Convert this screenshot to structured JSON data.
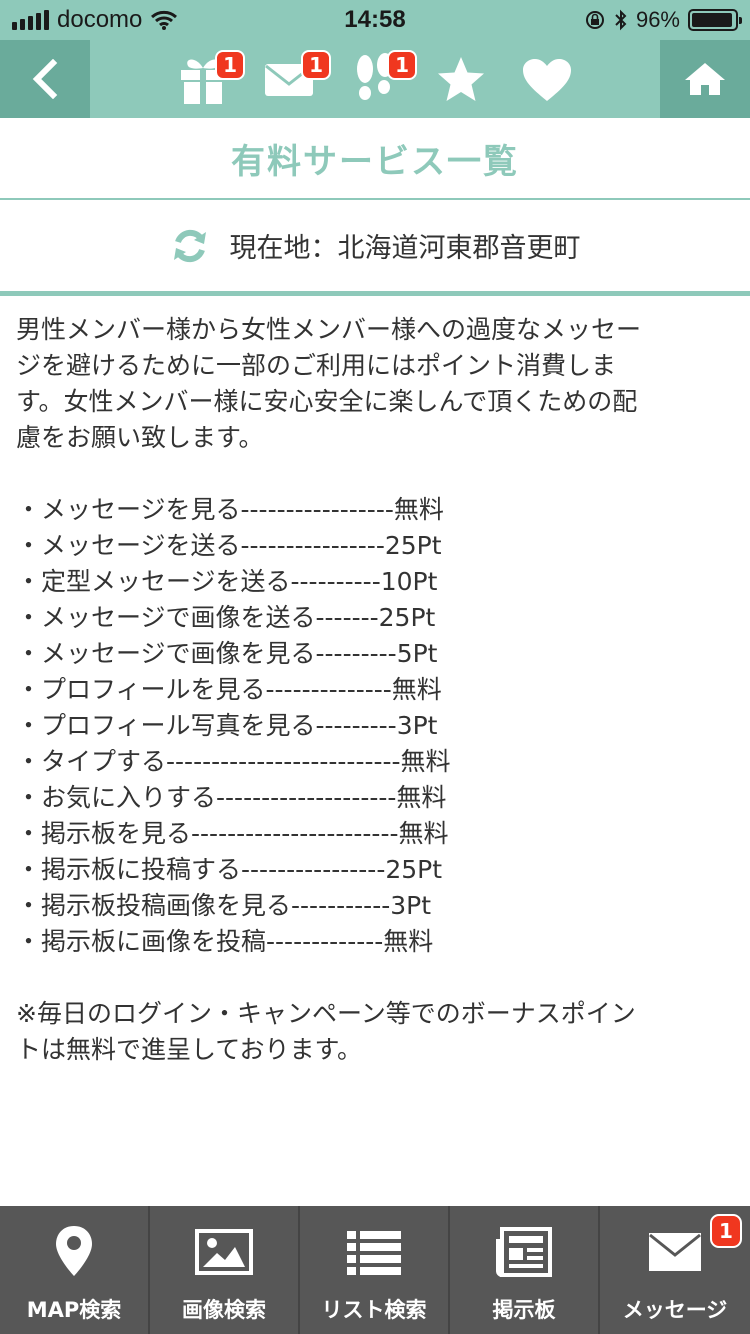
{
  "status_bar": {
    "carrier": "docomo",
    "time": "14:58",
    "battery_text": "96%",
    "battery_level_percent": 96,
    "icons": [
      "signal-icon",
      "wifi-icon",
      "orientation-lock-icon",
      "bluetooth-icon",
      "battery-icon"
    ]
  },
  "nav": {
    "back_icon": "chevron-left-icon",
    "home_icon": "home-icon",
    "items": [
      {
        "icon": "gift-icon",
        "badge": "1"
      },
      {
        "icon": "mail-icon",
        "badge": "1"
      },
      {
        "icon": "footprints-icon",
        "badge": "1"
      },
      {
        "icon": "star-icon",
        "badge": ""
      },
      {
        "icon": "heart-icon",
        "badge": ""
      }
    ]
  },
  "page": {
    "title": "有料サービス一覧",
    "location": "現在地：北海道河東郡音更町",
    "intro_lines": [
      "男性メンバー様から女性メンバー様への過度なメッセー",
      "ジを避けるために一部のご利用にはポイント消費しま",
      "す。女性メンバー様に安心安全に楽しんで頂くための配",
      "慮をお願い致します。"
    ],
    "services": [
      "・メッセージを見る-----------------無料",
      "・メッセージを送る----------------25Pt",
      "・定型メッセージを送る----------10Pt",
      "・メッセージで画像を送る-------25Pt",
      "・メッセージで画像を見る---------5Pt",
      "・プロフィールを見る--------------無料",
      "・プロフィール写真を見る---------3Pt",
      "・タイプする--------------------------無料",
      "・お気に入りする--------------------無料",
      "・掲示板を見る-----------------------無料",
      "・掲示板に投稿する----------------25Pt",
      "・掲示板投稿画像を見る-----------3Pt",
      "・掲示板に画像を投稿-------------無料"
    ],
    "note_lines": [
      "※毎日のログイン・キャンペーン等でのボーナスポイン",
      "トは無料で進呈しております。"
    ]
  },
  "tabs": [
    {
      "label": "MAP検索",
      "icon": "map-pin-icon",
      "badge": ""
    },
    {
      "label": "画像検索",
      "icon": "image-icon",
      "badge": ""
    },
    {
      "label": "リスト検索",
      "icon": "list-icon",
      "badge": ""
    },
    {
      "label": "掲示板",
      "icon": "newspaper-icon",
      "badge": ""
    },
    {
      "label": "メッセージ",
      "icon": "mail-icon",
      "badge": "1"
    }
  ],
  "colors": {
    "brand": "#8ec9ba",
    "brand_dark": "#6aab9b",
    "badge": "#f0371f",
    "tab_bar": "#575757"
  }
}
